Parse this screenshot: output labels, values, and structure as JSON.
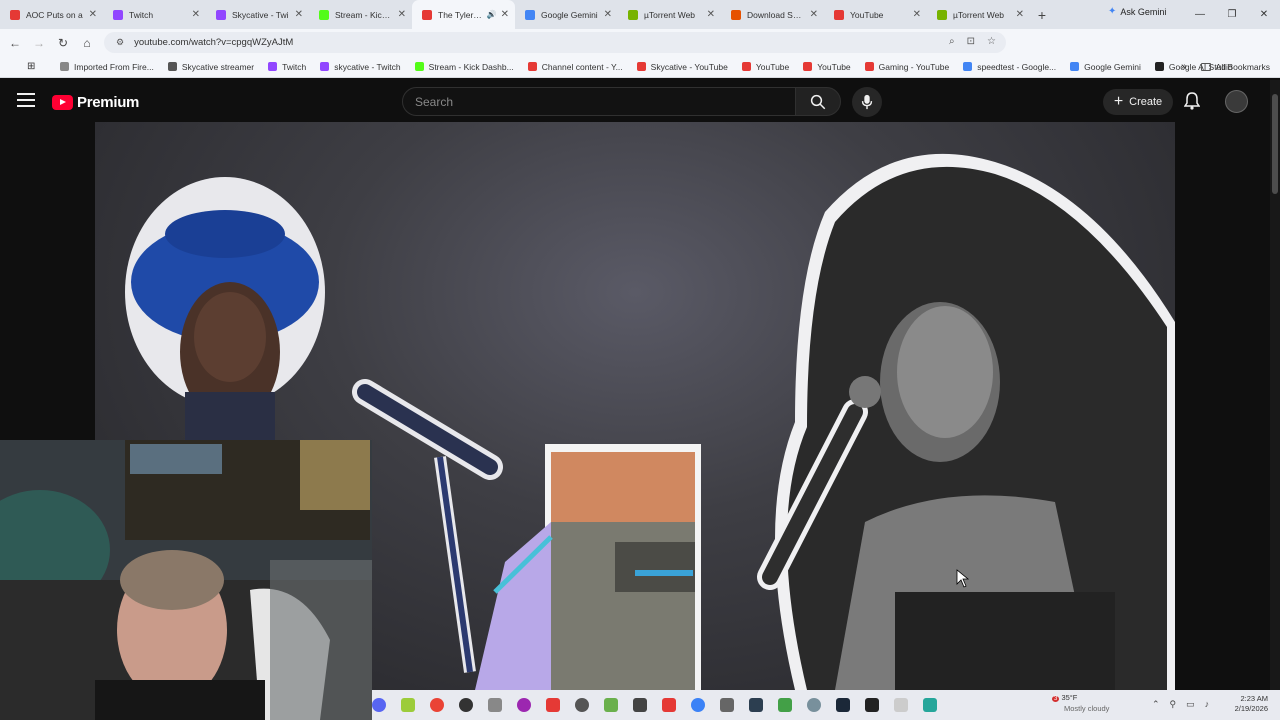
{
  "browser": {
    "tabs": [
      {
        "title": "AOC Puts on a",
        "color": "#e53935"
      },
      {
        "title": "Twitch",
        "color": "#9146ff"
      },
      {
        "title": "Skycative - Twi",
        "color": "#9146ff"
      },
      {
        "title": "Stream - Kick D",
        "color": "#53fc18"
      },
      {
        "title": "The Tyler Pe",
        "color": "#e53935",
        "active": true
      },
      {
        "title": "Google Gemini",
        "color": "#4285f4"
      },
      {
        "title": "µTorrent Web",
        "color": "#77b300"
      },
      {
        "title": "Download Suck",
        "color": "#e65100"
      },
      {
        "title": "YouTube",
        "color": "#e53935"
      },
      {
        "title": "µTorrent Web",
        "color": "#77b300"
      }
    ],
    "new_tab": "+",
    "ask_gemini": "Ask Gemini",
    "url": "youtube.com/watch?v=cpgqWZyAJtM",
    "bookmarks": [
      {
        "label": "Imported From Fire...",
        "color": "#888888"
      },
      {
        "label": "Skycative streamer",
        "color": "#555555"
      },
      {
        "label": "Twitch",
        "color": "#9146ff"
      },
      {
        "label": "skycative - Twitch",
        "color": "#9146ff"
      },
      {
        "label": "Stream - Kick Dashb...",
        "color": "#53fc18"
      },
      {
        "label": "Channel content - Y...",
        "color": "#e53935"
      },
      {
        "label": "Skycative - YouTube",
        "color": "#e53935"
      },
      {
        "label": "YouTube",
        "color": "#e53935"
      },
      {
        "label": "YouTube",
        "color": "#e53935"
      },
      {
        "label": "Gaming - YouTube",
        "color": "#e53935"
      },
      {
        "label": "speedtest - Google...",
        "color": "#4285f4"
      },
      {
        "label": "Google Gemini",
        "color": "#4285f4"
      },
      {
        "label": "Google AI Studio",
        "color": "#222222"
      }
    ],
    "all_bookmarks": "All Bookmarks"
  },
  "youtube": {
    "logo_text": "Premium",
    "search_placeholder": "Search",
    "create_label": "Create"
  },
  "taskbar": {
    "weather_temp": "35°F",
    "weather_desc": "Mostly cloudy",
    "weather_badge": "3",
    "time": "2:23 AM",
    "date": "2/19/2026"
  }
}
